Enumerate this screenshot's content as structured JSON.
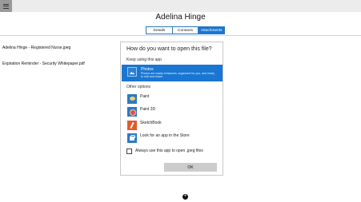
{
  "header": {
    "title": "Adelina Hinge"
  },
  "tabs": [
    {
      "label": "Details",
      "active": false
    },
    {
      "label": "Contacts",
      "active": false
    },
    {
      "label": "Attachments",
      "active": true
    }
  ],
  "attachments": [
    {
      "name": "Adelina Hinge - Registered Nurse.jpeg"
    },
    {
      "name": "Expiration Reminder - Security Whitepaper.pdf"
    }
  ],
  "dialog": {
    "title": "How do you want to open this file?",
    "keep_using_label": "Keep using this app",
    "selected_app": {
      "name": "Photos",
      "description": "Photos are easily enhanced, organized for you, and ready to edit and share.",
      "icon": "photos-icon"
    },
    "other_options_label": "Other options",
    "other_apps": [
      {
        "name": "Paint",
        "icon": "paint-icon"
      },
      {
        "name": "Paint 3D",
        "icon": "paint-3d-icon"
      },
      {
        "name": "SketchBook",
        "icon": "sketchbook-icon"
      },
      {
        "name": "Look for an app in the Store",
        "icon": "store-icon"
      }
    ],
    "always_use_label": "Always use this app to open .jpeg files",
    "always_use_checked": false,
    "ok_label": "OK"
  },
  "footer": {
    "add_button_label": "+"
  },
  "colors": {
    "accent": "#1976d2",
    "topbar": "#ececec"
  }
}
